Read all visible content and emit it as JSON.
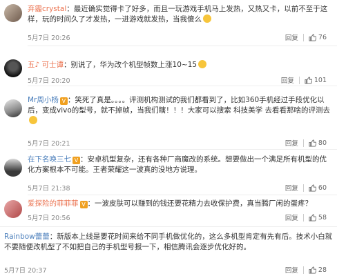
{
  "comments": [
    {
      "name": "弃霾crystal",
      "text": "：最近确实觉得卡了好多，而且一玩游戏手机马上发热，又热又卡，以前不至于这样，玩的时间久了才发热，一进游戏就发热，当我傻么",
      "time": "5月7日 20:26",
      "reply": "回复",
      "likes": "76"
    },
    {
      "name": "五♪ 可士谭",
      "text": "：别说了，华为改个机型帧数上涨10~15",
      "time": "5月7日 20:20",
      "reply": "回复",
      "likes": "101"
    },
    {
      "name": "Mr周小杨",
      "text": "：笑死了真是。。。。评测机构测试的我们都看到了，比如360手机经过手段优化以后，变成vivo的型号，就不掉帧，当我们瞎！！！大家可以搜索 科技美学 去看看那啥的评测去",
      "time": "5月7日 20:21",
      "reply": "回复",
      "likes": "80"
    },
    {
      "name": "在下名唤三七",
      "text": "：安卓机型复杂，还有各种厂商魔改的系统。想要做出一个满足所有机型的优化方案根本不可能。王者荣耀这一波真的没地方说理。",
      "time": "5月7日 21:38",
      "reply": "回复",
      "likes": "60"
    },
    {
      "name": "爱探险的菲菲菲",
      "text": "：一波皮肤可以赚到的钱还要花精力去收保护费，真当腾厂闲的蛋疼？",
      "time": "5月7日 20:56",
      "reply": "回复",
      "likes": "58"
    },
    {
      "name": "Rainbow蕾蕾",
      "text": "：新版本上线是要花时间来给不同手机做优化的，这么多机型肯定有先有后。技术小白就不要随便改机型了不如把自己的手机型号报一下，相信腾讯会逐步优化好的。",
      "time": "5月7日 20:37",
      "reply": "回复",
      "likes": "28"
    }
  ],
  "colors": {
    "name_orange": "#eb7350",
    "name_blue": "#4a7ebb",
    "time_gray": "#888888"
  },
  "icons": {
    "like": "thumb-up-icon",
    "emoji": "smile-emoji-icon"
  }
}
